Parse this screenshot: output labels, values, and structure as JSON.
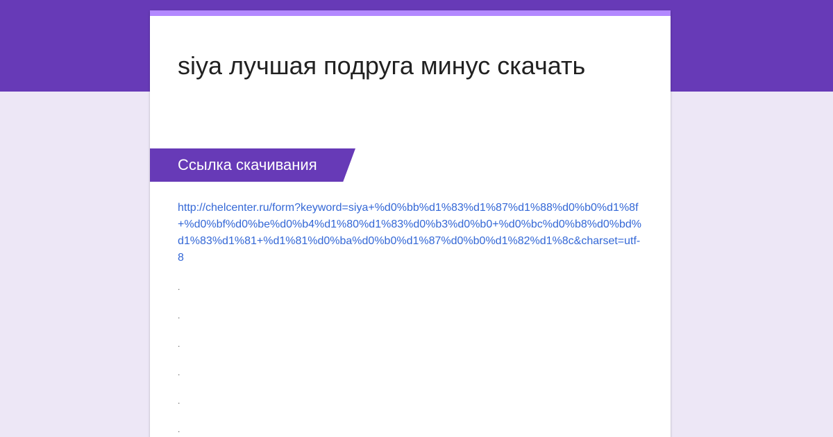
{
  "form": {
    "title": "siya лучшая подруга минус скачать",
    "section_title": "Ссылка скачивания",
    "link_text": "http://chelcenter.ru/form?keyword=siya+%d0%bb%d1%83%d1%87%d1%88%d0%b0%d1%8f+%d0%bf%d0%be%d0%b4%d1%80%d1%83%d0%b3%d0%b0+%d0%bc%d0%b8%d0%bd%d1%83%d1%81+%d1%81%d0%ba%d0%b0%d1%87%d0%b0%d1%82%d1%8c&charset=utf-8",
    "dots": [
      ".",
      ".",
      ".",
      ".",
      ".",
      "."
    ]
  },
  "colors": {
    "header": "#673ab7",
    "background": "#ede7f6",
    "accent": "#b388ff",
    "link": "#3367d6"
  }
}
